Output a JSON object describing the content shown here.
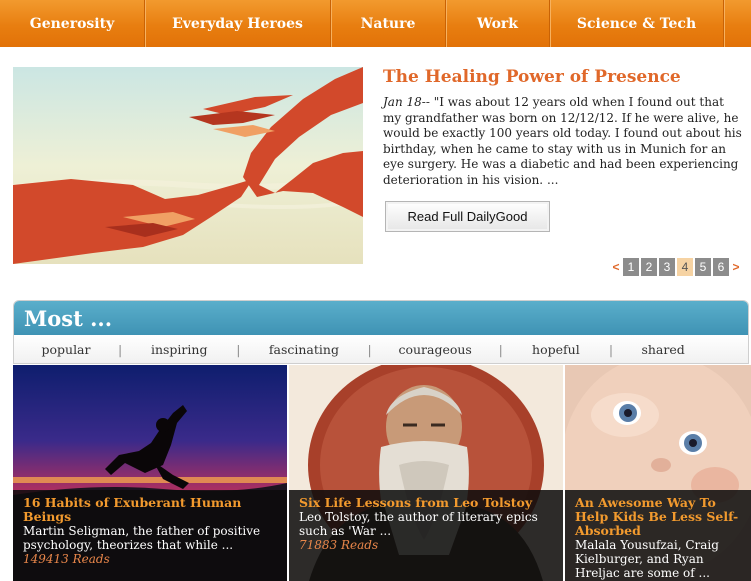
{
  "nav": {
    "items": [
      {
        "label": "Generosity"
      },
      {
        "label": "Everyday Heroes"
      },
      {
        "label": "Nature"
      },
      {
        "label": "Work"
      },
      {
        "label": "Science & Tech"
      }
    ]
  },
  "feature": {
    "title": "The Healing Power of Presence",
    "date": "Jan 18--",
    "excerpt": " \"I was about 12 years old when I found out that my grandfather was born on 12/12/12. If he were alive, he would be exactly 100 years old today. I found out about his birthday, when he came to stay with us in Munich for an eye surgery. He was a diabetic and had been experiencing deterioration in his vision. ...",
    "button_label": "Read Full DailyGood",
    "image_icon": "reaching-hands-icon"
  },
  "pager": {
    "prev": "<",
    "next": ">",
    "pages": [
      "1",
      "2",
      "3",
      "4",
      "5",
      "6"
    ],
    "current": "4"
  },
  "most": {
    "title": "Most ...",
    "tabs": [
      "popular",
      "inspiring",
      "fascinating",
      "courageous",
      "hopeful",
      "shared"
    ]
  },
  "cards": [
    {
      "title": "16 Habits of Exuberant Human Beings",
      "desc": "Martin Seligman, the father of positive psychology, theorizes that while ...",
      "reads": "149413 Reads"
    },
    {
      "title": "Six Life Lessons from Leo Tolstoy",
      "desc": "Leo Tolstoy, the author of literary epics such as 'War ...",
      "reads": "71883 Reads"
    },
    {
      "title": "An Awesome Way To Help Kids Be Less Self-Absorbed",
      "desc": "Malala Yousufzai, Craig Kielburger, and Ryan Hreljac are some of ...",
      "reads": ""
    }
  ],
  "colors": {
    "nav_orange": "#e87e10",
    "title_orange": "#e0682a",
    "most_blue": "#4a9fc0",
    "pager_active": "#f6d3a3"
  }
}
